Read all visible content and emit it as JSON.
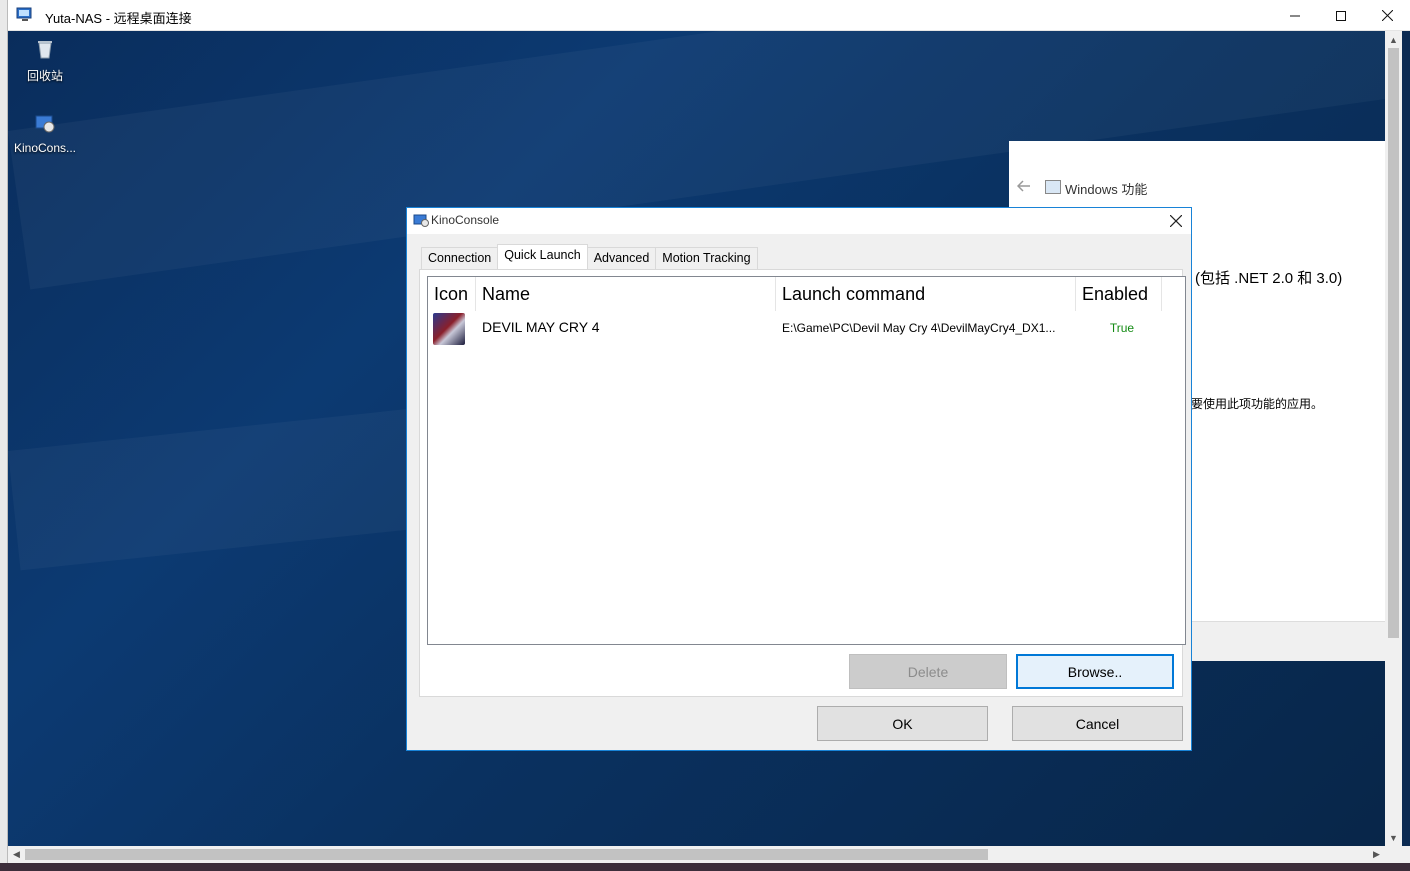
{
  "rdp": {
    "title": "Yuta-NAS - 远程桌面连接"
  },
  "desktop": {
    "icons": [
      {
        "label": "回收站"
      },
      {
        "label": "KinoCons..."
      }
    ]
  },
  "windows_features": {
    "title": "Windows 功能",
    "line1": "(包括 .NET 2.0 和 3.0)",
    "line2": "要使用此项功能的应用。"
  },
  "dialog": {
    "title": "KinoConsole",
    "tabs": [
      {
        "label": "Connection",
        "active": false
      },
      {
        "label": "Quick Launch",
        "active": true
      },
      {
        "label": "Advanced",
        "active": false
      },
      {
        "label": "Motion Tracking",
        "active": false
      }
    ],
    "list": {
      "columns": [
        "Icon",
        "Name",
        "Launch command",
        "Enabled"
      ],
      "rows": [
        {
          "name": "DEVIL MAY CRY 4",
          "command": "E:\\Game\\PC\\Devil May Cry 4\\DevilMayCry4_DX1...",
          "enabled": "True"
        }
      ]
    },
    "buttons": {
      "delete": "Delete",
      "browse": "Browse..",
      "ok": "OK",
      "cancel": "Cancel"
    }
  }
}
